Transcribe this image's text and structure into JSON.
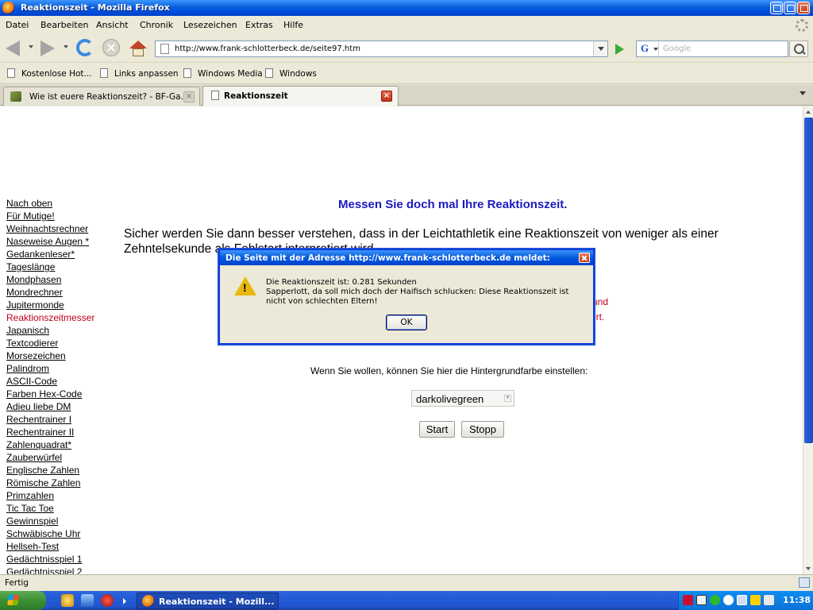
{
  "window": {
    "title": "Reaktionszeit - Mozilla Firefox"
  },
  "menu": [
    "Datei",
    "Bearbeiten",
    "Ansicht",
    "Chronik",
    "Lesezeichen",
    "Extras",
    "Hilfe"
  ],
  "navigation": {
    "url": "http://www.frank-schlotterbeck.de/seite97.htm",
    "search_engine": "G",
    "search_placeholder": "Google"
  },
  "bookmarks": [
    "Kostenlose Hot...",
    "Links anpassen",
    "Windows Media",
    "Windows"
  ],
  "tabs": [
    {
      "label": "Wie ist euere Reaktionszeit? - BF-Ga...",
      "active": false
    },
    {
      "label": "Reaktionszeit",
      "active": true
    }
  ],
  "page": {
    "heading": "Messen Sie doch mal Ihre Reaktionszeit.",
    "intro": "Sicher werden Sie dann besser verstehen, dass in der Leichtathletik eine Reaktionszeit von weniger als einer Zehntelsekunde als Fehlstart interpretiert wird.",
    "red_frag_1": "und",
    "red_frag_2": "ert.",
    "bg_label": "Wenn Sie wollen, können Sie hier die Hintergrundfarbe einstellen:",
    "bg_color_selected": "darkolivegreen",
    "start_label": "Start",
    "stop_label": "Stopp",
    "sidebar": [
      "Nach oben",
      "Für Mutige!",
      "Weihnachtsrechner",
      "Naseweise Augen *",
      "Gedankenleser*",
      "Tageslänge",
      "Mondphasen",
      "Mondrechner",
      "Jupitermonde",
      "Reaktionszeitmesser",
      "Japanisch",
      "Textcodierer",
      "Morsezeichen",
      "Palindrom",
      "ASCII-Code",
      "Farben Hex-Code",
      "Adieu liebe DM",
      "Rechentrainer I",
      "Rechentrainer II",
      "Zahlenquadrat*",
      "Zauberwürfel",
      "Englische Zahlen",
      "Römische Zahlen",
      "Primzahlen",
      "Tic Tac Toe",
      "Gewinnspiel",
      "Schwäbische Uhr",
      "Hellseh-Test",
      "Gedächtnisspiel 1",
      "Gedächtnisspiel 2"
    ],
    "sidebar_current": "Reaktionszeitmesser"
  },
  "dialog": {
    "title": "Die Seite mit der Adresse http://www.frank-schlotterbeck.de meldet:",
    "line1": "Die Reaktionszeit ist: 0.281 Sekunden",
    "line2": "Sapperlott, da soll mich doch der Haifisch schlucken: Diese Reaktionszeit ist nicht von schlechten Eltern!",
    "ok_label": "OK",
    "icon": "warning-icon"
  },
  "status": {
    "text": "Fertig"
  },
  "taskbar": {
    "task_label": "Reaktionszeit - Mozill...",
    "clock": "11:38"
  },
  "colors": {
    "heading": "#1a1ac0",
    "current_link": "#c0001a",
    "accent": "#0054e3"
  }
}
